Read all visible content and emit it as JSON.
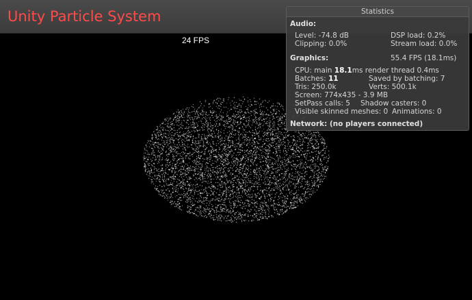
{
  "app_title": "Unity Particle System",
  "fps_readout": "24 FPS",
  "statistics": {
    "title": "Statistics",
    "audio": {
      "heading": "Audio:",
      "level": "Level: -74.8 dB",
      "dsp_load": "DSP load: 0.2%",
      "clipping": "Clipping: 0.0%",
      "stream_load": "Stream load: 0.0%"
    },
    "graphics": {
      "heading": "Graphics:",
      "fps": "55.4 FPS (18.1ms)",
      "cpu_label": "CPU: main ",
      "cpu_main": "18.1",
      "cpu_rest": "ms  render thread 0.4ms",
      "batches_label": "Batches: ",
      "batches": "11",
      "saved_by_batching": "Saved by batching: 7",
      "tris": "Tris: 250.0k",
      "verts": "Verts: 500.1k",
      "screen": "Screen: 774x435 - 3.9 MB",
      "setpass": "SetPass calls: 5",
      "shadow_casters": "Shadow casters: 0",
      "skinned_meshes": "Visible skinned meshes: 0",
      "animations": "Animations: 0"
    },
    "network": "Network: (no players connected)"
  },
  "colors": {
    "title_text": "#ff4a4a",
    "particle": "#ffffff",
    "background": "#000000"
  }
}
